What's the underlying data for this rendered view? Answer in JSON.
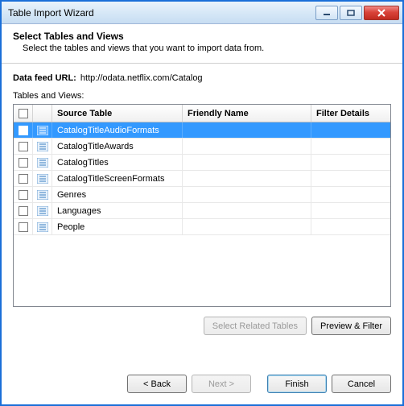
{
  "window": {
    "title": "Table Import Wizard"
  },
  "header": {
    "title": "Select Tables and Views",
    "subtitle": "Select the tables and views that you want to import data from."
  },
  "feed": {
    "label": "Data feed URL:",
    "url": "http://odata.netflix.com/Catalog"
  },
  "tables_label": "Tables and Views:",
  "columns": {
    "source": "Source Table",
    "friendly": "Friendly Name",
    "filter": "Filter Details"
  },
  "rows": [
    {
      "name": "CatalogTitleAudioFormats",
      "friendly": "",
      "filter": "",
      "checked": true,
      "selected": true
    },
    {
      "name": "CatalogTitleAwards",
      "friendly": "",
      "filter": "",
      "checked": false,
      "selected": false
    },
    {
      "name": "CatalogTitles",
      "friendly": "",
      "filter": "",
      "checked": false,
      "selected": false
    },
    {
      "name": "CatalogTitleScreenFormats",
      "friendly": "",
      "filter": "",
      "checked": false,
      "selected": false
    },
    {
      "name": "Genres",
      "friendly": "",
      "filter": "",
      "checked": false,
      "selected": false
    },
    {
      "name": "Languages",
      "friendly": "",
      "filter": "",
      "checked": false,
      "selected": false
    },
    {
      "name": "People",
      "friendly": "",
      "filter": "",
      "checked": false,
      "selected": false
    }
  ],
  "buttons": {
    "select_related": "Select Related Tables",
    "preview_filter": "Preview & Filter",
    "back": "< Back",
    "next": "Next >",
    "finish": "Finish",
    "cancel": "Cancel"
  },
  "state": {
    "select_related_enabled": false,
    "next_enabled": false
  }
}
